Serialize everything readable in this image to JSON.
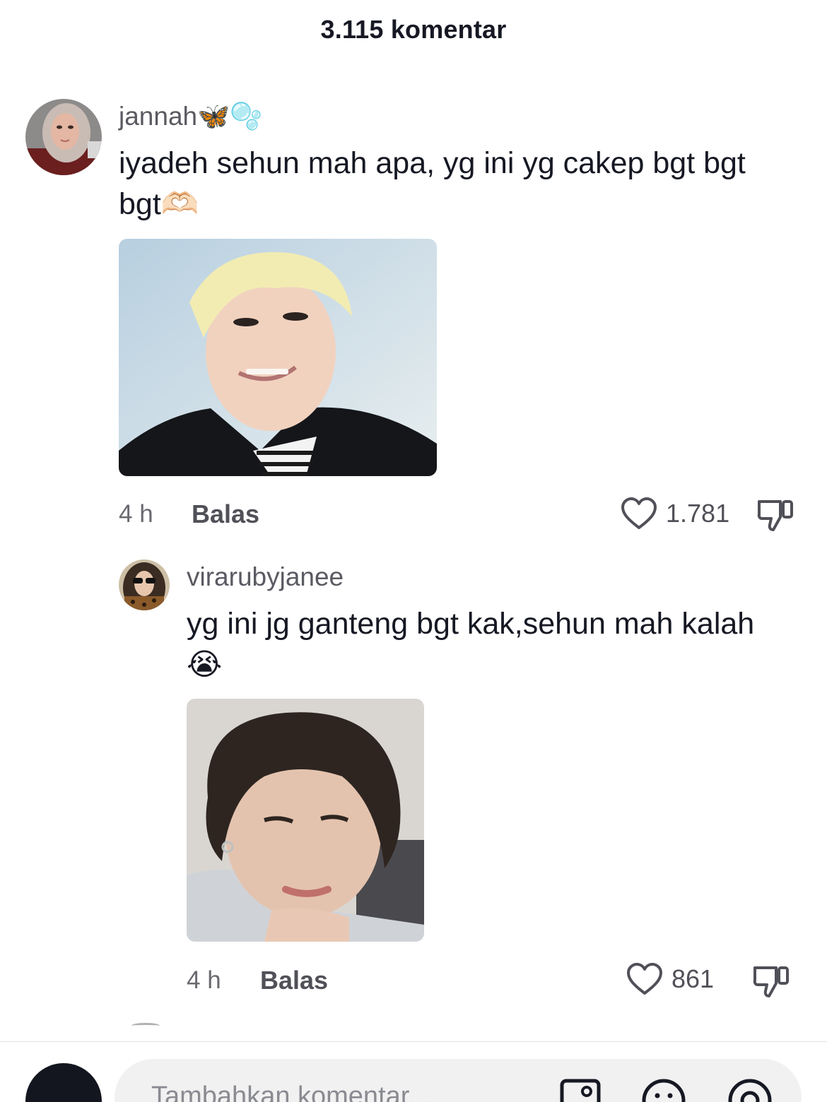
{
  "header": {
    "title": "3.115 komentar"
  },
  "comments": [
    {
      "username": "jannah🦋🫧",
      "text": "iyadeh sehun mah apa, yg ini yg cakep bgt bgt bgt🫶🏻",
      "time": "4 h",
      "reply_label": "Balas",
      "likes": "1.781",
      "avatar_icon": "user-avatar-photo",
      "image_desc_icon": "attached-photo"
    },
    {
      "username": "virarubyjanee",
      "text": "yg ini jg ganteng bgt kak,sehun mah kalah😭",
      "time": "4 h",
      "reply_label": "Balas",
      "likes": "861",
      "avatar_icon": "user-avatar-photo",
      "image_desc_icon": "attached-photo"
    }
  ],
  "composer": {
    "placeholder": "Tambahkan komentar..."
  },
  "colors": {
    "text": "#161823",
    "muted": "#6a6a70",
    "input_bg": "#f1f1f2"
  }
}
